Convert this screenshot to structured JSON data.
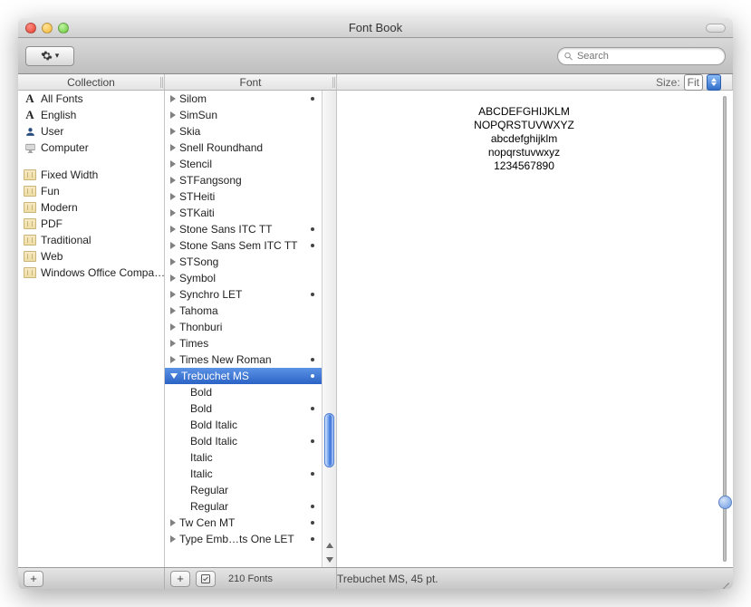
{
  "window": {
    "title": "Font Book"
  },
  "toolbar": {
    "search_placeholder": "Search"
  },
  "headers": {
    "collection": "Collection",
    "font": "Font",
    "size_label": "Size:",
    "size_value": "Fit"
  },
  "collections_top": [
    {
      "label": "All Fonts",
      "icon": "fontA"
    },
    {
      "label": "English",
      "icon": "fontA"
    },
    {
      "label": "User",
      "icon": "user"
    },
    {
      "label": "Computer",
      "icon": "comp"
    }
  ],
  "collections_bottom": [
    {
      "label": "Fixed Width"
    },
    {
      "label": "Fun"
    },
    {
      "label": "Modern"
    },
    {
      "label": "PDF"
    },
    {
      "label": "Traditional"
    },
    {
      "label": "Web"
    },
    {
      "label": "Windows Office Compa…"
    }
  ],
  "fonts": [
    {
      "label": "Silom",
      "dot": true
    },
    {
      "label": "SimSun"
    },
    {
      "label": "Skia"
    },
    {
      "label": "Snell Roundhand"
    },
    {
      "label": "Stencil"
    },
    {
      "label": "STFangsong"
    },
    {
      "label": "STHeiti"
    },
    {
      "label": "STKaiti"
    },
    {
      "label": "Stone Sans ITC TT",
      "dot": true
    },
    {
      "label": "Stone Sans Sem ITC TT",
      "dot": true
    },
    {
      "label": "STSong"
    },
    {
      "label": "Symbol"
    },
    {
      "label": "Synchro LET",
      "dot": true
    },
    {
      "label": "Tahoma"
    },
    {
      "label": "Thonburi"
    },
    {
      "label": "Times"
    },
    {
      "label": "Times New Roman",
      "dot": true
    },
    {
      "label": "Trebuchet MS",
      "dot": true,
      "selected": true,
      "expanded": true,
      "children": [
        {
          "label": "Bold"
        },
        {
          "label": "Bold",
          "dot": true
        },
        {
          "label": "Bold Italic"
        },
        {
          "label": "Bold Italic",
          "dot": true
        },
        {
          "label": "Italic"
        },
        {
          "label": "Italic",
          "dot": true
        },
        {
          "label": "Regular"
        },
        {
          "label": "Regular",
          "dot": true
        }
      ]
    },
    {
      "label": "Tw Cen MT",
      "dot": true
    },
    {
      "label": "Type Emb…ts One LET",
      "dot": true
    }
  ],
  "preview": {
    "line1": "ABCDEFGHIJKLM",
    "line2": "NOPQRSTUVWXYZ",
    "line3": "abcdefghijklm",
    "line4": "nopqrstuvwxyz",
    "line5": "1234567890"
  },
  "footer": {
    "count": "210 Fonts",
    "status": "Trebuchet MS, 45 pt."
  }
}
